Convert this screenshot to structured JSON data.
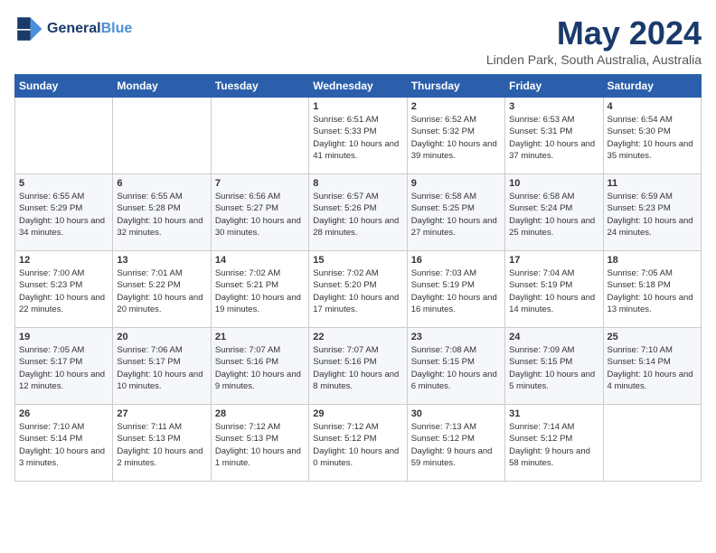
{
  "header": {
    "logo_line1": "General",
    "logo_line2": "Blue",
    "month_year": "May 2024",
    "location": "Linden Park, South Australia, Australia"
  },
  "days_of_week": [
    "Sunday",
    "Monday",
    "Tuesday",
    "Wednesday",
    "Thursday",
    "Friday",
    "Saturday"
  ],
  "weeks": [
    [
      {
        "day": "",
        "sunrise": "",
        "sunset": "",
        "daylight": ""
      },
      {
        "day": "",
        "sunrise": "",
        "sunset": "",
        "daylight": ""
      },
      {
        "day": "",
        "sunrise": "",
        "sunset": "",
        "daylight": ""
      },
      {
        "day": "1",
        "sunrise": "6:51 AM",
        "sunset": "5:33 PM",
        "daylight": "10 hours and 41 minutes."
      },
      {
        "day": "2",
        "sunrise": "6:52 AM",
        "sunset": "5:32 PM",
        "daylight": "10 hours and 39 minutes."
      },
      {
        "day": "3",
        "sunrise": "6:53 AM",
        "sunset": "5:31 PM",
        "daylight": "10 hours and 37 minutes."
      },
      {
        "day": "4",
        "sunrise": "6:54 AM",
        "sunset": "5:30 PM",
        "daylight": "10 hours and 35 minutes."
      }
    ],
    [
      {
        "day": "5",
        "sunrise": "6:55 AM",
        "sunset": "5:29 PM",
        "daylight": "10 hours and 34 minutes."
      },
      {
        "day": "6",
        "sunrise": "6:55 AM",
        "sunset": "5:28 PM",
        "daylight": "10 hours and 32 minutes."
      },
      {
        "day": "7",
        "sunrise": "6:56 AM",
        "sunset": "5:27 PM",
        "daylight": "10 hours and 30 minutes."
      },
      {
        "day": "8",
        "sunrise": "6:57 AM",
        "sunset": "5:26 PM",
        "daylight": "10 hours and 28 minutes."
      },
      {
        "day": "9",
        "sunrise": "6:58 AM",
        "sunset": "5:25 PM",
        "daylight": "10 hours and 27 minutes."
      },
      {
        "day": "10",
        "sunrise": "6:58 AM",
        "sunset": "5:24 PM",
        "daylight": "10 hours and 25 minutes."
      },
      {
        "day": "11",
        "sunrise": "6:59 AM",
        "sunset": "5:23 PM",
        "daylight": "10 hours and 24 minutes."
      }
    ],
    [
      {
        "day": "12",
        "sunrise": "7:00 AM",
        "sunset": "5:23 PM",
        "daylight": "10 hours and 22 minutes."
      },
      {
        "day": "13",
        "sunrise": "7:01 AM",
        "sunset": "5:22 PM",
        "daylight": "10 hours and 20 minutes."
      },
      {
        "day": "14",
        "sunrise": "7:02 AM",
        "sunset": "5:21 PM",
        "daylight": "10 hours and 19 minutes."
      },
      {
        "day": "15",
        "sunrise": "7:02 AM",
        "sunset": "5:20 PM",
        "daylight": "10 hours and 17 minutes."
      },
      {
        "day": "16",
        "sunrise": "7:03 AM",
        "sunset": "5:19 PM",
        "daylight": "10 hours and 16 minutes."
      },
      {
        "day": "17",
        "sunrise": "7:04 AM",
        "sunset": "5:19 PM",
        "daylight": "10 hours and 14 minutes."
      },
      {
        "day": "18",
        "sunrise": "7:05 AM",
        "sunset": "5:18 PM",
        "daylight": "10 hours and 13 minutes."
      }
    ],
    [
      {
        "day": "19",
        "sunrise": "7:05 AM",
        "sunset": "5:17 PM",
        "daylight": "10 hours and 12 minutes."
      },
      {
        "day": "20",
        "sunrise": "7:06 AM",
        "sunset": "5:17 PM",
        "daylight": "10 hours and 10 minutes."
      },
      {
        "day": "21",
        "sunrise": "7:07 AM",
        "sunset": "5:16 PM",
        "daylight": "10 hours and 9 minutes."
      },
      {
        "day": "22",
        "sunrise": "7:07 AM",
        "sunset": "5:16 PM",
        "daylight": "10 hours and 8 minutes."
      },
      {
        "day": "23",
        "sunrise": "7:08 AM",
        "sunset": "5:15 PM",
        "daylight": "10 hours and 6 minutes."
      },
      {
        "day": "24",
        "sunrise": "7:09 AM",
        "sunset": "5:15 PM",
        "daylight": "10 hours and 5 minutes."
      },
      {
        "day": "25",
        "sunrise": "7:10 AM",
        "sunset": "5:14 PM",
        "daylight": "10 hours and 4 minutes."
      }
    ],
    [
      {
        "day": "26",
        "sunrise": "7:10 AM",
        "sunset": "5:14 PM",
        "daylight": "10 hours and 3 minutes."
      },
      {
        "day": "27",
        "sunrise": "7:11 AM",
        "sunset": "5:13 PM",
        "daylight": "10 hours and 2 minutes."
      },
      {
        "day": "28",
        "sunrise": "7:12 AM",
        "sunset": "5:13 PM",
        "daylight": "10 hours and 1 minute."
      },
      {
        "day": "29",
        "sunrise": "7:12 AM",
        "sunset": "5:12 PM",
        "daylight": "10 hours and 0 minutes."
      },
      {
        "day": "30",
        "sunrise": "7:13 AM",
        "sunset": "5:12 PM",
        "daylight": "9 hours and 59 minutes."
      },
      {
        "day": "31",
        "sunrise": "7:14 AM",
        "sunset": "5:12 PM",
        "daylight": "9 hours and 58 minutes."
      },
      {
        "day": "",
        "sunrise": "",
        "sunset": "",
        "daylight": ""
      }
    ]
  ]
}
